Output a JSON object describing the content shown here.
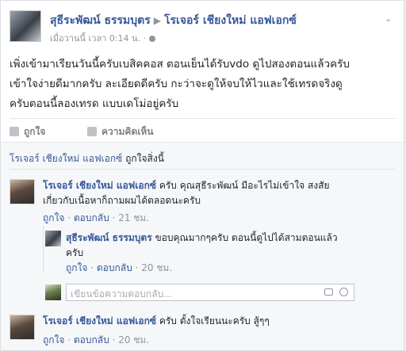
{
  "post": {
    "author": "สุธีระพัฒน์ ธรรมบุตร",
    "target": "โรเจอร์ เชียงใหม่ แอฟเอกซ์",
    "time": "เมื่อวานนี้ เวลา 0:14 น. ·",
    "body_lines": [
      "เพิ่งเข้ามาเรียนวันนี้ครับเบสิคคอส ตอนเย็นได้รับvdo ดูไปสองตอนแล้วครับ",
      "เข้าใจง่ายดีมากครับ ละเอียดดีครับ กะว่าจะดูให้จบให้ไวและใช้เทรดจริงดู",
      "ครับตอนนี้ลองเทรด แบบเดโม่อยู่ครับ"
    ],
    "like_label": "ถูกใจ",
    "comment_label": "ความคิดเห็น"
  },
  "likes": {
    "who": "โรเจอร์ เชียงใหม่ แอฟเอกซ์",
    "suffix": " ถูกใจสิ่งนี้"
  },
  "comments": [
    {
      "author": "โรเจอร์ เชียงใหม่ แอฟเอกซ์",
      "text": " ครับ คุณสุธีระพัฒน์ มีอะไรไม่เข้าใจ สงสัย",
      "text2": "เกี่ยวกับเนื้อหาก็ถามผมได้ตลอดนะครับ",
      "like": "ถูกใจ",
      "reply": "ตอบกลับ",
      "time": "21 ชม."
    },
    {
      "author": "สุธีระพัฒน์ ธรรมบุตร",
      "text": " ขอบคุณมากๆครับ ตอนนี้ดูไปได้สามตอนแล้ว",
      "text2": "ครับ",
      "like": "ถูกใจ",
      "reply": "ตอบกลับ",
      "time": "20 ชม."
    },
    {
      "author": "โรเจอร์ เชียงใหม่ แอฟเอกซ์",
      "text": " ครับ ตั้งใจเรียนนะครับ สู้ๆๆ",
      "like": "ถูกใจ",
      "reply": "ตอบกลับ",
      "time": "20 ชม."
    }
  ],
  "reply_input": {
    "placeholder": "เขียนข้อความตอบกลับ..."
  }
}
